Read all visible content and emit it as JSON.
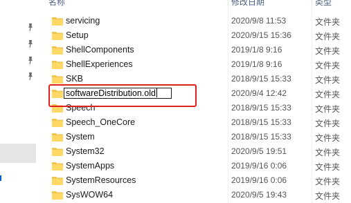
{
  "header": {
    "name_label": "名称",
    "date_label": "修改日期",
    "type_label": "类型"
  },
  "rename_value": "softwareDistribution.old",
  "rows": [
    {
      "name": "servicing",
      "date": "2020/9/8 11:53",
      "type": "文件夹"
    },
    {
      "name": "Setup",
      "date": "2020/9/15 15:36",
      "type": "文件夹"
    },
    {
      "name": "ShellComponents",
      "date": "2019/1/8 9:16",
      "type": "文件夹"
    },
    {
      "name": "ShellExperiences",
      "date": "2019/1/8 9:16",
      "type": "文件夹"
    },
    {
      "name": "SKB",
      "date": "2018/9/15 15:33",
      "type": "文件夹"
    },
    {
      "name": "softwareDistribution.old",
      "date": "2020/9/4 12:42",
      "type": "文件夹"
    },
    {
      "name": "Speech",
      "date": "2018/9/15 15:33",
      "type": "文件夹"
    },
    {
      "name": "Speech_OneCore",
      "date": "2018/9/15 15:33",
      "type": "文件夹"
    },
    {
      "name": "System",
      "date": "2018/9/15 15:33",
      "type": "文件夹"
    },
    {
      "name": "System32",
      "date": "2020/9/5 19:51",
      "type": "文件夹"
    },
    {
      "name": "SystemApps",
      "date": "2019/9/16 0:06",
      "type": "文件夹"
    },
    {
      "name": "SystemResources",
      "date": "2019/9/16 0:06",
      "type": "文件夹"
    },
    {
      "name": "SysWOW64",
      "date": "2020/9/5 19:43",
      "type": "文件夹"
    }
  ],
  "icons": {
    "pin": "pin-icon",
    "folder": "folder-icon"
  },
  "colors": {
    "folder": "#f2c54f",
    "highlight_box": "#e0201c"
  }
}
